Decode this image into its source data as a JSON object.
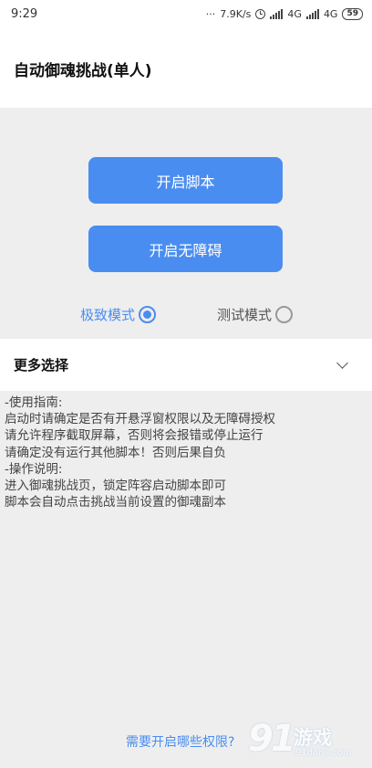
{
  "status_bar": {
    "time": "9:29",
    "net_speed": "7.9K/s",
    "sim1_type": "4G",
    "sim2_type": "4G",
    "battery": "59"
  },
  "header": {
    "title": "自动御魂挑战(单人)"
  },
  "buttons": {
    "start_script": "开启脚本",
    "start_accessibility": "开启无障碍"
  },
  "modes": {
    "extreme": {
      "label": "极致模式",
      "selected": true
    },
    "test": {
      "label": "测试模式",
      "selected": false
    }
  },
  "more_options": {
    "label": "更多选择"
  },
  "guide": {
    "lines": [
      "-使用指南:",
      "启动时请确定是否有开悬浮窗权限以及无障碍授权",
      "请允许程序截取屏幕，否则将会报错或停止运行",
      "请确定没有运行其他脚本！否则后果自负",
      "-操作说明:",
      "进入御魂挑战页，锁定阵容启动脚本即可",
      "脚本会自动点击挑战当前设置的御魂副本"
    ]
  },
  "permissions_link": "需要开启哪些权限?",
  "watermark": {
    "logo": "91",
    "name": "游戏",
    "url": "91danji.com"
  },
  "colors": {
    "accent": "#4a8df0",
    "background": "#eeeeee"
  }
}
